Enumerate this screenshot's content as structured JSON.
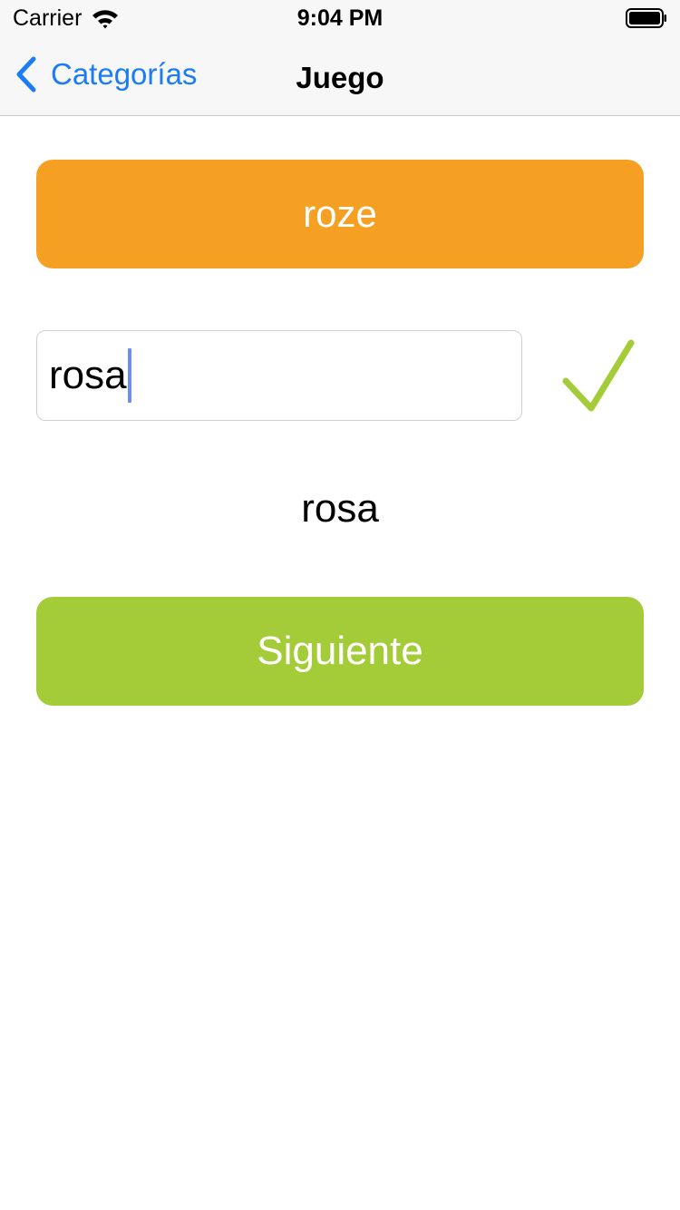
{
  "status_bar": {
    "carrier": "Carrier",
    "time": "9:04 PM",
    "icons": [
      "wifi-icon",
      "battery-icon"
    ]
  },
  "nav": {
    "back_label": "Categorías",
    "back_icon": "chevron-left-icon",
    "title": "Juego",
    "accent_color": "#1b7cf6"
  },
  "game": {
    "prompt_word": "roze",
    "prompt_color": "#f6a023",
    "answer_value": "rosa",
    "answer_status_icon": "checkmark-icon",
    "answer_status_color": "#a4cb38",
    "correct_answer": "rosa",
    "next_label": "Siguiente",
    "next_color": "#a4cb38"
  }
}
